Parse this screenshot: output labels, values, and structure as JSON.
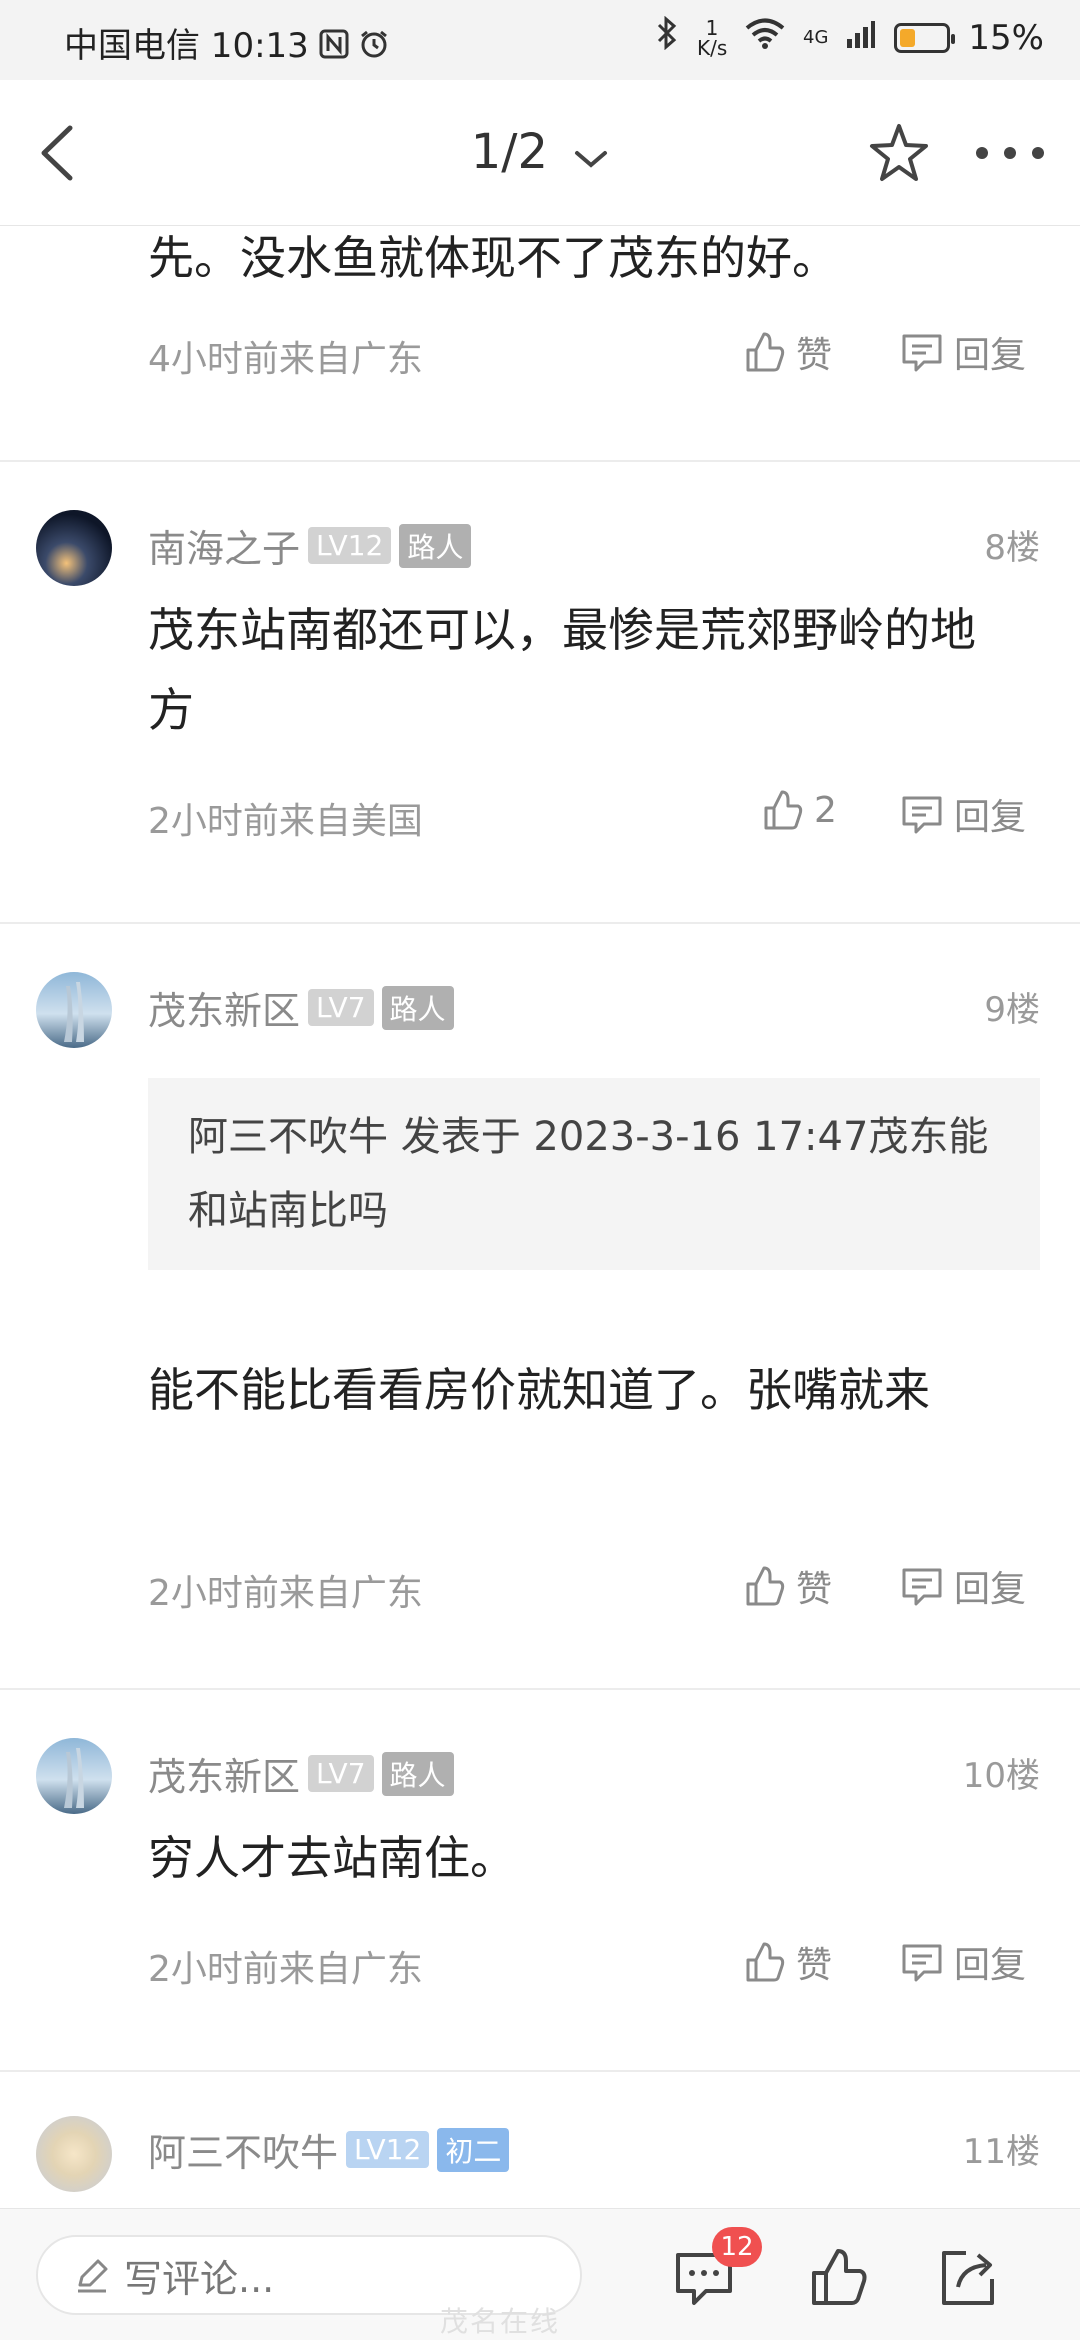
{
  "status_bar": {
    "carrier_time": "中国电信 10:13",
    "net_speed": "1 K/s",
    "signal": "4G",
    "battery": "15%",
    "battery_level": 0.15,
    "battery_color": "#f4a92a"
  },
  "header": {
    "title": "1/2",
    "icons": [
      "back-icon",
      "chevron-down-icon",
      "star-icon",
      "more-icon"
    ]
  },
  "posts": [
    {
      "text": "先。没水鱼就体现不了茂东的好。",
      "meta": "4小时前来自广东",
      "like_label": "赞",
      "reply_label": "回复"
    },
    {
      "username": "南海之子",
      "level": "LV12",
      "tag": "路人",
      "floor": "8楼",
      "text": "茂东站南都还可以，最惨是荒郊野岭的地方",
      "meta": "2小时前来自美国",
      "like_label": "2",
      "reply_label": "回复"
    },
    {
      "username": "茂东新区",
      "level": "LV7",
      "tag": "路人",
      "floor": "9楼",
      "quote": "阿三不吹牛 发表于 2023-3-16 17:47茂东能和站南比吗",
      "text": "能不能比看看房价就知道了。张嘴就来",
      "meta": "2小时前来自广东",
      "like_label": "赞",
      "reply_label": "回复"
    },
    {
      "username": "茂东新区",
      "level": "LV7",
      "tag": "路人",
      "floor": "10楼",
      "text": "穷人才去站南住。",
      "meta": "2小时前来自广东",
      "like_label": "赞",
      "reply_label": "回复"
    },
    {
      "username": "阿三不吹牛",
      "level": "LV12",
      "tag": "初二",
      "floor": "11楼"
    }
  ],
  "bottom_bar": {
    "placeholder": "写评论...",
    "comment_count": "12"
  },
  "watermark": "茂名在线"
}
